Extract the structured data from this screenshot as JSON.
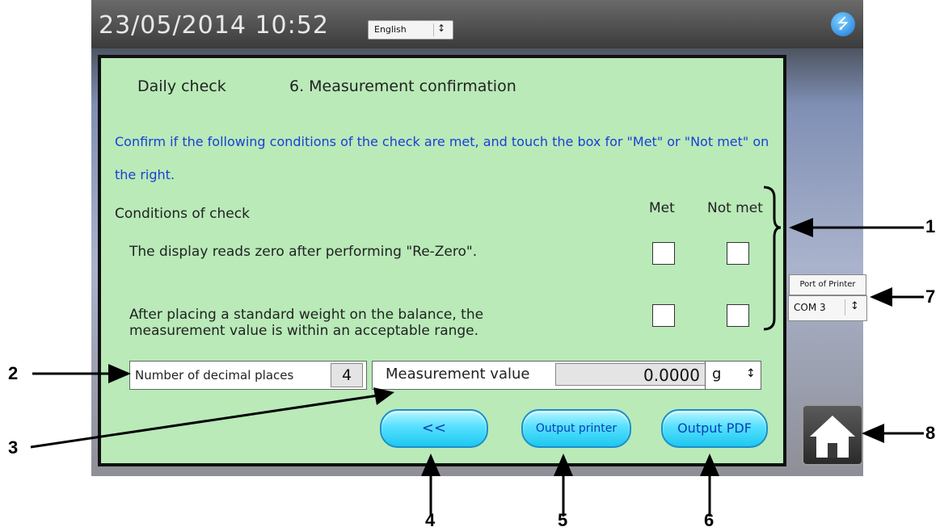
{
  "header": {
    "datetime": "23/05/2014  10:52",
    "language": "English"
  },
  "panel": {
    "title_left": "Daily check",
    "title_right": "6. Measurement confirmation",
    "instruction": "Confirm if the following conditions of the check are met, and touch the box for \"Met\" or \"Not met\" on the right.",
    "conditions_header": "Conditions of check",
    "met_header": "Met",
    "not_met_header": "Not met",
    "condition_1": "The display reads zero after performing \"Re-Zero\".",
    "condition_2_line1": "After placing a standard weight on the balance, the",
    "condition_2_line2": "measurement value is within an acceptable range."
  },
  "decimal": {
    "label": "Number of decimal places",
    "value": "4"
  },
  "measurement": {
    "label": "Measurement value",
    "value": "0.0000",
    "unit": "g"
  },
  "buttons": {
    "back": "<<",
    "output_printer": "Output printer",
    "output_pdf": "Output PDF"
  },
  "printer_port": {
    "label": "Port of Printer",
    "value": "COM 3"
  },
  "callouts": [
    "1",
    "2",
    "3",
    "4",
    "5",
    "6",
    "7",
    "8"
  ],
  "colors": {
    "panel_bg": "#b9eab8",
    "instruction_text": "#1a3fd6",
    "button": "#3fd6f7"
  }
}
